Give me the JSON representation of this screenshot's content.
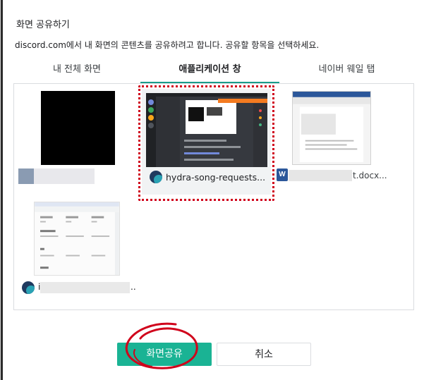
{
  "dialog": {
    "title": "화면 공유하기",
    "subtitle": "discord.com에서 내 화면의 콘텐츠를 공유하려고 합니다. 공유할 항목을 선택하세요."
  },
  "tabs": [
    {
      "label": "내 전체 화면",
      "selected": false
    },
    {
      "label": "애플리케이션 창",
      "selected": true
    },
    {
      "label": "네이버 웨일 탭",
      "selected": false
    }
  ],
  "items": [
    {
      "label": "",
      "type": "screen"
    },
    {
      "label": "hydra-song-requests...",
      "type": "discord-window",
      "selected": true
    },
    {
      "label": "t.docx...",
      "type": "word-document"
    },
    {
      "label": "i",
      "type": "browser-window"
    }
  ],
  "ellipsis": "..",
  "word_icon_letter": "W",
  "buttons": {
    "share": "화면공유",
    "cancel": "취소"
  },
  "colors": {
    "accent": "#1ab394",
    "tab_underline": "#1a9c8a",
    "selection_outline": "#d0021b"
  }
}
